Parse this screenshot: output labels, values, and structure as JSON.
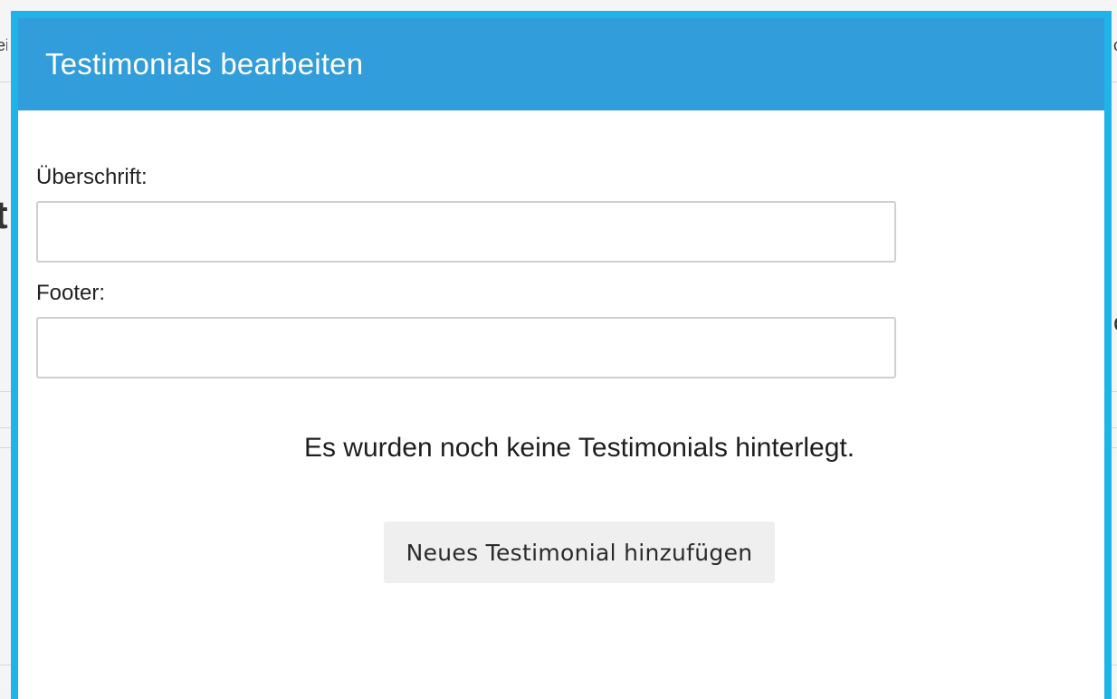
{
  "background": {
    "fragment_left_top": "ei",
    "fragment_left_big": "t",
    "fragment_right_top": "c",
    "fragment_right_mid": "c"
  },
  "modal": {
    "title": "Testimonials bearbeiten",
    "heading_label": "Überschrift:",
    "heading_value": "",
    "heading_placeholder": "",
    "footer_label": "Footer:",
    "footer_value": "",
    "footer_placeholder": "",
    "empty_message": "Es wurden noch keine Testimonials hinterlegt.",
    "add_button_label": "Neues Testimonial hinzufügen"
  },
  "colors": {
    "header": "#329ddb",
    "border_accent": "#1eb4ea",
    "button_bg": "#efefef"
  }
}
